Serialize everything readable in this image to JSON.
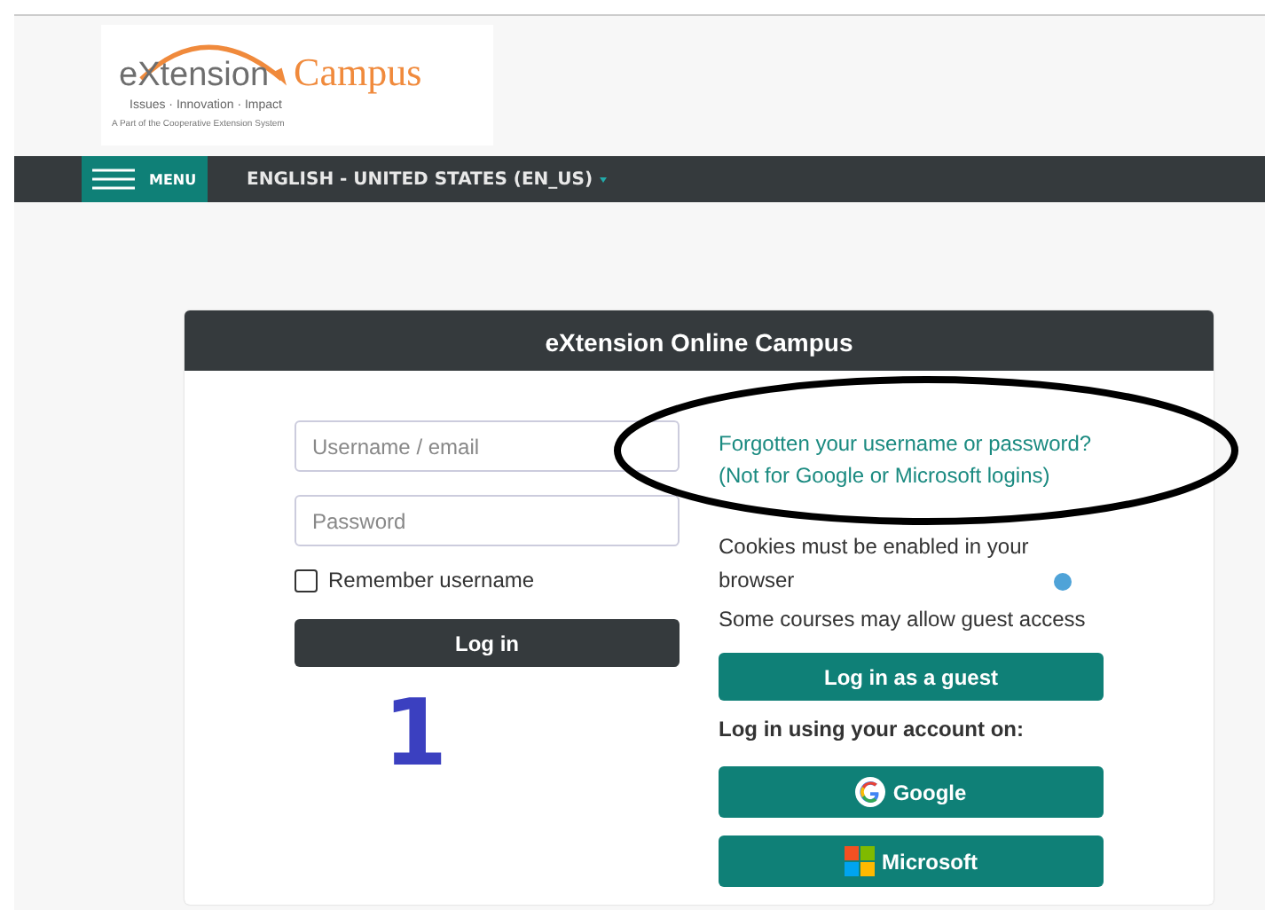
{
  "logo": {
    "brand": "eXtension",
    "product": "Campus",
    "tagline": "Issues · Innovation · Impact",
    "subline": "A Part of the Cooperative Extension System"
  },
  "nav": {
    "menu": "MENU",
    "language": "ENGLISH - UNITED STATES (EN_US)"
  },
  "login": {
    "title": "eXtension Online Campus",
    "username": {
      "placeholder": "Username / email"
    },
    "password": {
      "placeholder": "Password"
    },
    "remember": {
      "label": "Remember username",
      "checked": false
    },
    "submit": "Log in",
    "forgot": "Forgotten your username or password? (Not for Google or Microsoft logins)",
    "cookies": "Cookies must be enabled in your browser",
    "guest_note": "Some courses may allow guest access",
    "guest_button": "Log in as a guest",
    "providers_label": "Log in using your account on:",
    "providers": [
      {
        "kind": "google",
        "label": "Google"
      },
      {
        "kind": "microsoft",
        "label": "Microsoft"
      }
    ]
  },
  "annotation": {
    "number": "1"
  }
}
